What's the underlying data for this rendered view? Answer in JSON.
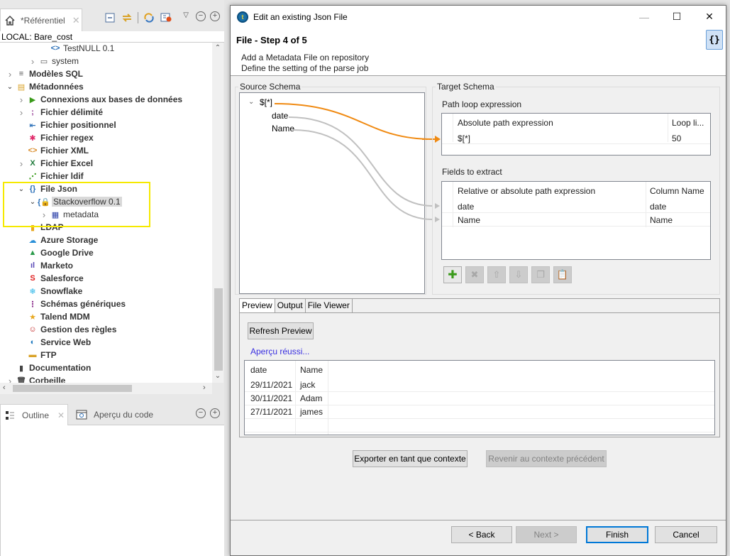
{
  "left_panel": {
    "view_tab": {
      "label": "*Référentiel",
      "icon": "home-icon"
    },
    "toolbar_icons": [
      "collapse-all-icon",
      "link-with-editor-icon",
      "refresh-icon",
      "filter-icon"
    ],
    "repo_root": "LOCAL: Bare_cost",
    "tree": [
      {
        "label": "TestNULL 0.1",
        "icon": "job-file-icon",
        "bold": false,
        "expander": "none",
        "level": 3
      },
      {
        "label": "system",
        "icon": "folder-icon",
        "bold": false,
        "expander": "collapsed",
        "level": 2
      },
      {
        "label": "Modèles SQL",
        "icon": "sql-templates-icon",
        "bold": true,
        "expander": "collapsed",
        "level": 0
      },
      {
        "label": "Métadonnées",
        "icon": "metadata-icon",
        "bold": true,
        "expander": "expanded",
        "level": 0
      },
      {
        "label": "Connexions aux bases de données",
        "icon": "db-connection-icon",
        "bold": true,
        "expander": "collapsed",
        "level": 1
      },
      {
        "label": "Fichier délimité",
        "icon": "delimited-file-icon",
        "bold": true,
        "expander": "collapsed",
        "level": 1
      },
      {
        "label": "Fichier positionnel",
        "icon": "positional-file-icon",
        "bold": true,
        "expander": "none",
        "level": 1
      },
      {
        "label": "Fichier regex",
        "icon": "regex-file-icon",
        "bold": true,
        "expander": "none",
        "level": 1
      },
      {
        "label": "Fichier XML",
        "icon": "xml-file-icon",
        "bold": true,
        "expander": "none",
        "level": 1
      },
      {
        "label": "Fichier Excel",
        "icon": "excel-file-icon",
        "bold": true,
        "expander": "collapsed",
        "level": 1
      },
      {
        "label": "Fichier ldif",
        "icon": "ldif-file-icon",
        "bold": true,
        "expander": "none",
        "level": 1
      },
      {
        "label": "File Json",
        "icon": "json-file-icon",
        "bold": true,
        "expander": "expanded",
        "level": 1
      },
      {
        "label": "Stackoverflow 0.1",
        "icon": "json-locked-icon",
        "bold": false,
        "expander": "expanded",
        "level": 2,
        "selected": true
      },
      {
        "label": "metadata",
        "icon": "table-icon",
        "bold": false,
        "expander": "collapsed",
        "level": 3
      },
      {
        "label": "LDAP",
        "icon": "ldap-icon",
        "bold": true,
        "expander": "none",
        "level": 1
      },
      {
        "label": "Azure Storage",
        "icon": "azure-storage-icon",
        "bold": true,
        "expander": "none",
        "level": 1
      },
      {
        "label": "Google Drive",
        "icon": "google-drive-icon",
        "bold": true,
        "expander": "none",
        "level": 1
      },
      {
        "label": "Marketo",
        "icon": "marketo-icon",
        "bold": true,
        "expander": "none",
        "level": 1
      },
      {
        "label": "Salesforce",
        "icon": "salesforce-icon",
        "bold": true,
        "expander": "none",
        "level": 1
      },
      {
        "label": "Snowflake",
        "icon": "snowflake-icon",
        "bold": true,
        "expander": "none",
        "level": 1
      },
      {
        "label": "Schémas génériques",
        "icon": "generic-schema-icon",
        "bold": true,
        "expander": "none",
        "level": 1
      },
      {
        "label": "Talend MDM",
        "icon": "mdm-icon",
        "bold": true,
        "expander": "none",
        "level": 1
      },
      {
        "label": "Gestion des règles",
        "icon": "rules-icon",
        "bold": true,
        "expander": "none",
        "level": 1
      },
      {
        "label": "Service Web",
        "icon": "web-service-icon",
        "bold": true,
        "expander": "none",
        "level": 1
      },
      {
        "label": "FTP",
        "icon": "ftp-icon",
        "bold": true,
        "expander": "none",
        "level": 1
      },
      {
        "label": "Documentation",
        "icon": "documentation-icon",
        "bold": true,
        "expander": "none",
        "level": 0
      },
      {
        "label": "Corbeille",
        "icon": "trash-icon",
        "bold": true,
        "expander": "collapsed",
        "level": 0
      }
    ],
    "outline_tabs": [
      {
        "label": "Outline",
        "icon": "outline-icon",
        "active": true
      },
      {
        "label": "Aperçu du code",
        "icon": "code-preview-icon",
        "active": false
      }
    ]
  },
  "dialog": {
    "title": "Edit an existing Json File",
    "step_title": "File - Step 4 of 5",
    "description": [
      "Add a Metadata File on repository",
      "Define the setting of the parse job"
    ],
    "source_schema": {
      "legend": "Source Schema",
      "root": "$[*]",
      "children": [
        "date",
        "Name"
      ]
    },
    "target_schema": {
      "legend": "Target Schema",
      "path_loop": {
        "label": "Path loop expression",
        "headers": [
          "Absolute path expression",
          "Loop li..."
        ],
        "rows": [
          [
            "$[*]",
            "50"
          ]
        ]
      },
      "fields": {
        "label": "Fields to extract",
        "headers": [
          "Relative or absolute path expression",
          "Column Name"
        ],
        "rows": [
          [
            "date",
            "date"
          ],
          [
            "Name",
            "Name"
          ]
        ]
      },
      "field_buttons": [
        {
          "icon": "add-icon",
          "enabled": true
        },
        {
          "icon": "delete-icon",
          "enabled": false
        },
        {
          "icon": "move-up-icon",
          "enabled": false
        },
        {
          "icon": "move-down-icon",
          "enabled": false
        },
        {
          "icon": "copy-icon",
          "enabled": false
        },
        {
          "icon": "paste-icon",
          "enabled": false
        }
      ]
    },
    "link_colors": {
      "loop": "#f08a12",
      "field": "#c0c0c0"
    },
    "preview": {
      "tabs": [
        "Preview",
        "Output",
        "File Viewer"
      ],
      "active_tab": "Preview",
      "refresh_label": "Refresh Preview",
      "status": "Aperçu réussi...",
      "headers": [
        "date",
        "Name"
      ],
      "rows": [
        [
          "29/11/2021",
          "jack"
        ],
        [
          "30/11/2021",
          "Adam"
        ],
        [
          "27/11/2021",
          "james"
        ]
      ]
    },
    "context_buttons": {
      "export": "Exporter en tant que contexte",
      "revert": "Revenir au contexte précédent"
    },
    "footer": {
      "back": "< Back",
      "next": "Next >",
      "finish": "Finish",
      "cancel": "Cancel"
    }
  }
}
